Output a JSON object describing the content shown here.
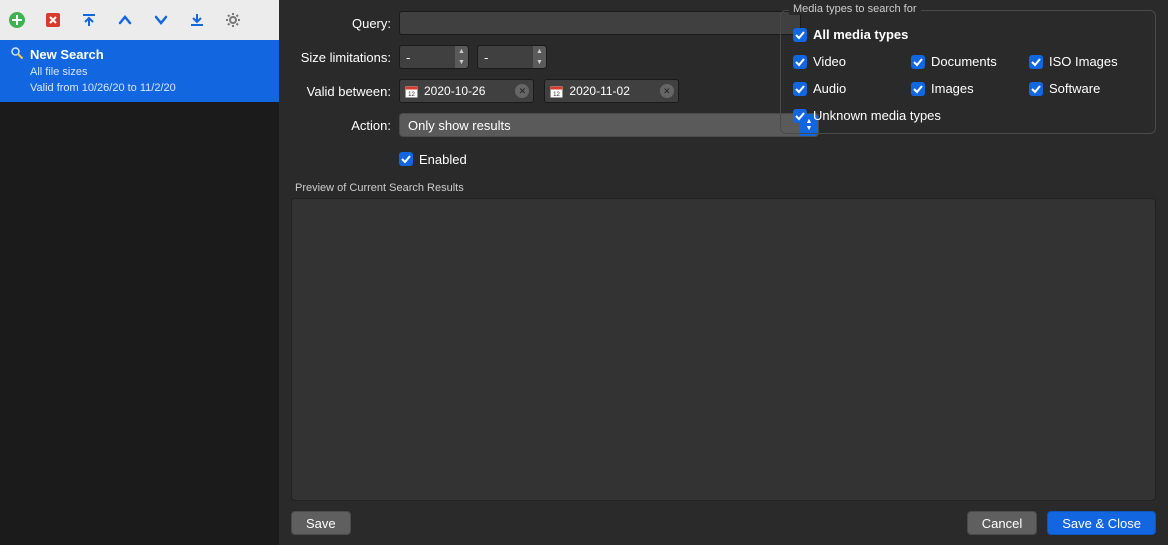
{
  "sidebar": {
    "items": [
      {
        "title": "New Search",
        "sub1": "All file sizes",
        "sub2": "Valid from 10/26/20 to 11/2/20"
      }
    ]
  },
  "form": {
    "query_label": "Query:",
    "query_value": "",
    "size_label": "Size limitations:",
    "size_min": "-",
    "size_max": "-",
    "valid_label": "Valid between:",
    "date_from": "2020-10-26",
    "date_to": "2020-11-02",
    "action_label": "Action:",
    "action_value": "Only show results",
    "enabled_label": "Enabled"
  },
  "media": {
    "group_title": "Media types to search for",
    "all": "All media types",
    "video": "Video",
    "documents": "Documents",
    "iso": "ISO Images",
    "audio": "Audio",
    "images": "Images",
    "software": "Software",
    "unknown": "Unknown media types"
  },
  "preview": {
    "label": "Preview of Current Search Results"
  },
  "footer": {
    "save": "Save",
    "cancel": "Cancel",
    "save_close": "Save & Close"
  },
  "colors": {
    "accent": "#1267e0"
  }
}
